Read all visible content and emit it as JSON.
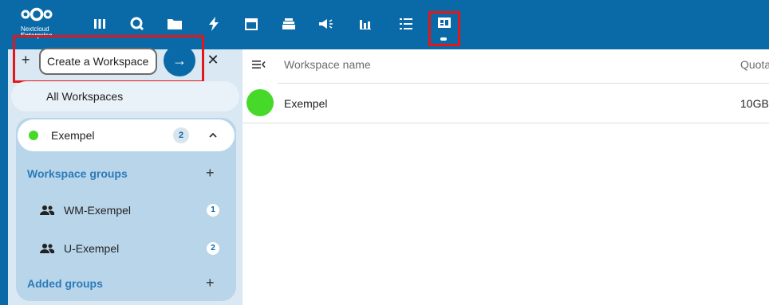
{
  "header": {
    "logo_name": "Nextcloud",
    "logo_edition": "Enterprise",
    "apps": [
      {
        "icon": "dashboard-icon"
      },
      {
        "icon": "search-icon"
      },
      {
        "icon": "files-icon"
      },
      {
        "icon": "activity-icon"
      },
      {
        "icon": "calendar-icon"
      },
      {
        "icon": "deck-icon"
      },
      {
        "icon": "announcements-icon"
      },
      {
        "icon": "analytics-icon"
      },
      {
        "icon": "tasks-icon"
      },
      {
        "icon": "workspace-icon"
      }
    ],
    "active_app": "workspace-icon",
    "accent_color": "#0a6aa8",
    "highlight_color": "#e3161b"
  },
  "sidebar": {
    "new_placeholder": "Create a Workspace",
    "all_label": "All Workspaces",
    "workspace": {
      "name": "Exempel",
      "count": "2",
      "color": "#46d929"
    },
    "workspace_groups_title": "Workspace groups",
    "groups": [
      {
        "name": "WM-Exempel",
        "count": "1"
      },
      {
        "name": "U-Exempel",
        "count": "2"
      }
    ],
    "added_groups_title": "Added groups"
  },
  "main": {
    "columns": {
      "name": "Workspace name",
      "quota": "Quota"
    },
    "rows": [
      {
        "name": "Exempel",
        "quota": "10GB",
        "color": "#46d929"
      }
    ]
  }
}
